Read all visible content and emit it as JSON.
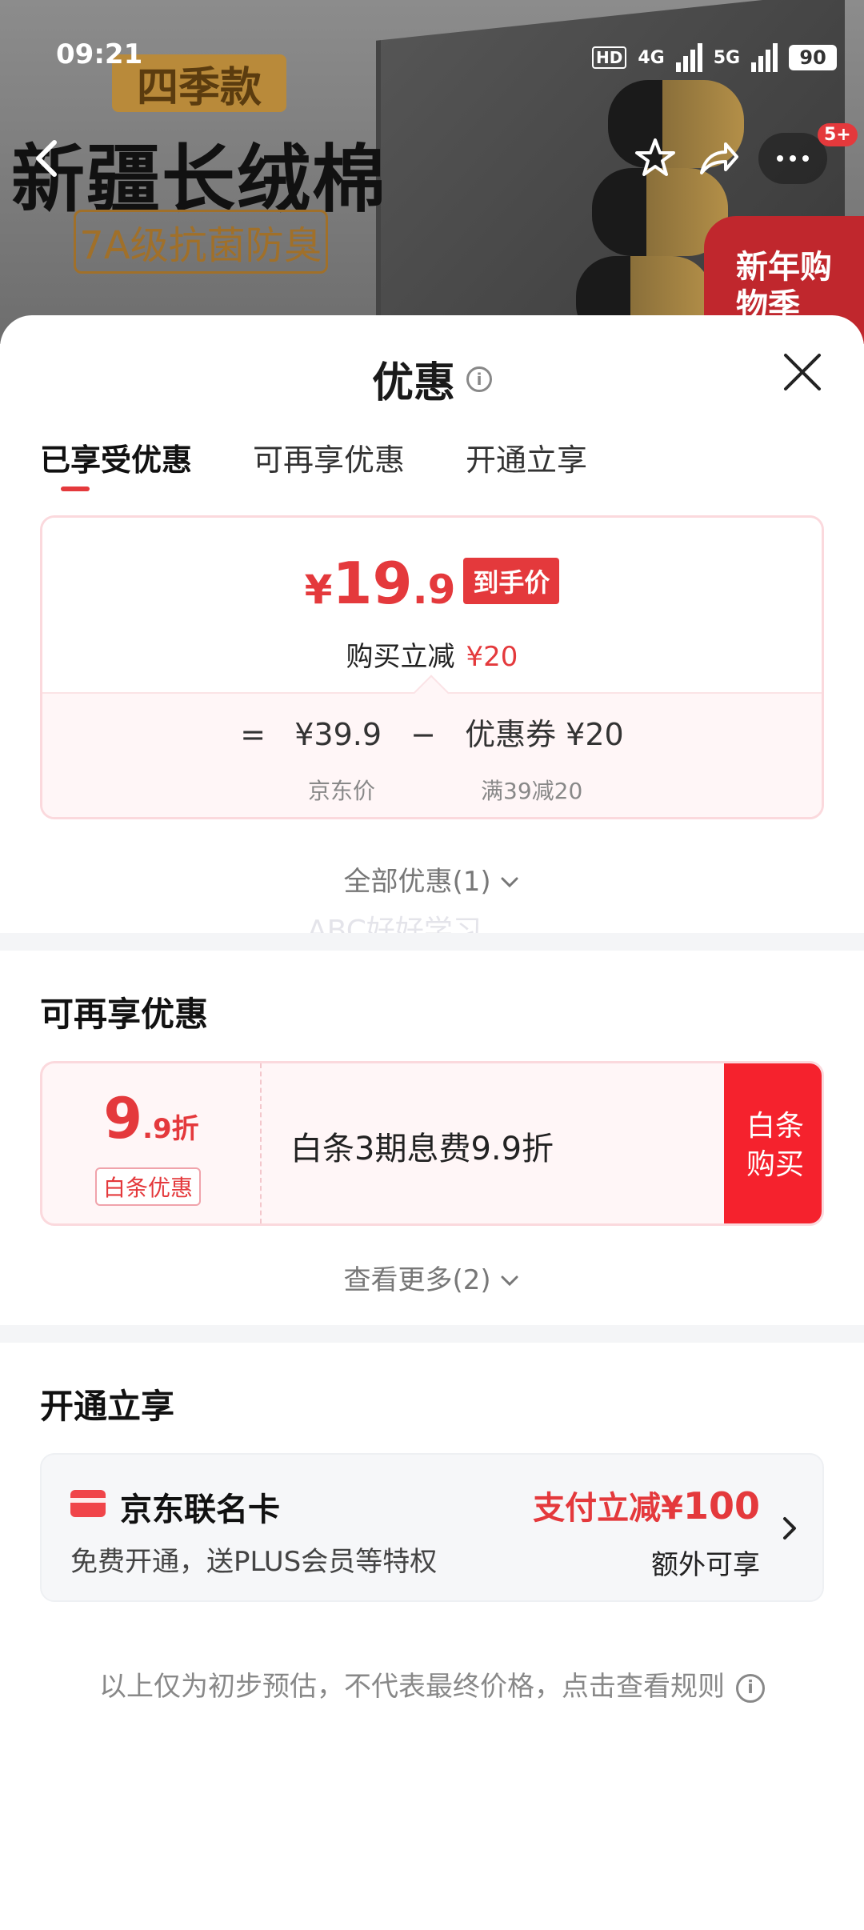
{
  "status_bar": {
    "time": "09:21",
    "hd": "HD",
    "network_a": "4G",
    "network_b": "5G",
    "battery": "90"
  },
  "banner": {
    "season_badge": "四季款",
    "headline": "新疆长绒棉",
    "subline": "7A级抗菌防臭",
    "promo": "新年购物季",
    "nav_badge": "5+"
  },
  "sheet": {
    "title": "优惠",
    "tabs": [
      "已享受优惠",
      "可再享优惠",
      "开通立享"
    ],
    "price": {
      "yen": "¥",
      "integer": "19",
      "decimal": ".9",
      "tag": "到手价",
      "reduce_label": "购买立减",
      "reduce_amount": "¥20"
    },
    "formula": {
      "equals": "=",
      "base_price": "¥39.9",
      "minus": "−",
      "coupon": "优惠券 ¥20",
      "base_label": "京东价",
      "coupon_rule": "满39减20"
    },
    "all_offers": "全部优惠(1)",
    "watermark": "ABC好好学习",
    "more_section": {
      "title": "可再享优惠",
      "discount_big": "9",
      "discount_small": ".9折",
      "label": "白条优惠",
      "desc": "白条3期息费9.9折",
      "button": [
        "白条",
        "购买"
      ],
      "see_more": "查看更多(2)"
    },
    "open_section": {
      "title": "开通立享",
      "card_name": "京东联名卡",
      "card_desc": "免费开通，送PLUS会员等特权",
      "benefit_prefix": "支付立减¥",
      "benefit_amount": "100",
      "extra": "额外可享"
    },
    "footnote": "以上仅为初步预估，不代表最终价格，点击查看规则"
  },
  "colors": {
    "accent": "#e4393c",
    "buy_button": "#f5222d",
    "card_bg": "#fff6f7"
  }
}
